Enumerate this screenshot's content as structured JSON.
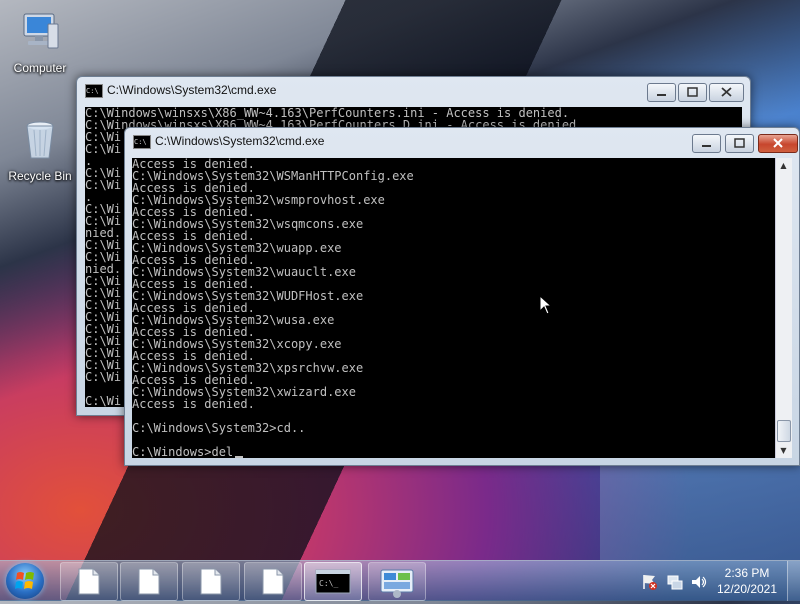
{
  "desktop": {
    "icons": [
      {
        "label": "Computer",
        "icon": "computer-icon"
      },
      {
        "label": "Recycle Bin",
        "icon": "recycle-bin-icon"
      }
    ]
  },
  "back_window": {
    "title": "C:\\Windows\\System32\\cmd.exe",
    "lines": [
      "C:\\Windows\\winsxs\\X86_WW~4.163\\PerfCounters.ini - Access is denied.",
      "C:\\Windows\\winsxs\\X86_WW~4.163\\PerfCounters_D.ini - Access is denied.",
      "C:\\Wi",
      "C:\\Wi",
      ".",
      "C:\\Wi",
      "C:\\Wi",
      ".",
      "C:\\Wi",
      "C:\\Wi",
      "nied.",
      "C:\\Wi",
      "C:\\Wi",
      "nied.",
      "C:\\Wi",
      "C:\\Wi",
      "C:\\Wi",
      "C:\\Wi",
      "C:\\Wi",
      "C:\\Wi",
      "C:\\Wi",
      "C:\\Wi",
      "C:\\Wi",
      "",
      "C:\\Wi"
    ]
  },
  "front_window": {
    "title": "C:\\Windows\\System32\\cmd.exe",
    "lines": [
      "Access is denied.",
      "C:\\Windows\\System32\\WSManHTTPConfig.exe",
      "Access is denied.",
      "C:\\Windows\\System32\\wsmprovhost.exe",
      "Access is denied.",
      "C:\\Windows\\System32\\wsqmcons.exe",
      "Access is denied.",
      "C:\\Windows\\System32\\wuapp.exe",
      "Access is denied.",
      "C:\\Windows\\System32\\wuauclt.exe",
      "Access is denied.",
      "C:\\Windows\\System32\\WUDFHost.exe",
      "Access is denied.",
      "C:\\Windows\\System32\\wusa.exe",
      "Access is denied.",
      "C:\\Windows\\System32\\xcopy.exe",
      "Access is denied.",
      "C:\\Windows\\System32\\xpsrchvw.exe",
      "Access is denied.",
      "C:\\Windows\\System32\\xwizard.exe",
      "Access is denied.",
      "",
      "C:\\Windows\\System32>cd..",
      "",
      "C:\\Windows>del"
    ]
  },
  "taskbar": {
    "buttons": [
      {
        "icon": "document-icon"
      },
      {
        "icon": "document-icon"
      },
      {
        "icon": "document-icon"
      },
      {
        "icon": "document-icon"
      },
      {
        "icon": "cmd-icon"
      },
      {
        "icon": "control-panel-icon"
      }
    ],
    "tray_icons": [
      "action-center-flag-icon",
      "network-icon",
      "volume-icon"
    ],
    "time": "2:36 PM",
    "date": "12/20/2021"
  }
}
